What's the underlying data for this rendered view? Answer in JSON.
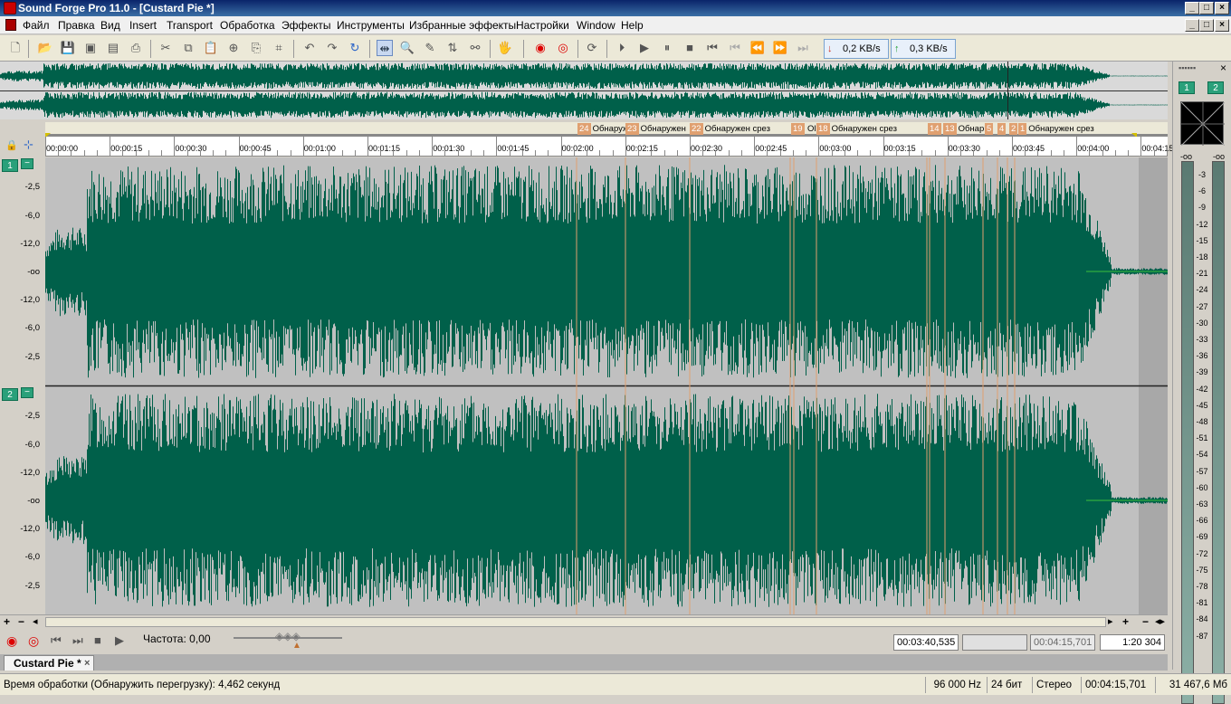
{
  "window": {
    "title": "Sound Forge Pro 11.0 - [Custard Pie *]"
  },
  "menu": [
    "Файл",
    "Правка",
    "Вид",
    "Insert",
    "Transport",
    "Обработка",
    "Эффекты",
    "Инструменты",
    "Избранные эффекты",
    "Настройки",
    "Window",
    "Help"
  ],
  "toolbar": {
    "download_rate": "0,2 KB/s",
    "upload_rate": "0,3 KB/s"
  },
  "markers": [
    {
      "num": "24",
      "label": "Обнаруж"
    },
    {
      "num": "23",
      "label": "Обнаружен"
    },
    {
      "num": "22",
      "label": "Обнаружен срез"
    },
    {
      "num": "19",
      "label": ""
    },
    {
      "num": "",
      "label": "Ol"
    },
    {
      "num": "18",
      "label": "Обнаружен срез"
    },
    {
      "num": "14",
      "label": ""
    },
    {
      "num": "13",
      "label": "Обнар"
    },
    {
      "num": "5",
      "label": ""
    },
    {
      "num": "4",
      "label": ""
    },
    {
      "num": "2",
      "label": ""
    },
    {
      "num": "1",
      "label": "Обнаружен срез"
    }
  ],
  "ruler": [
    "00:00:00",
    "00:00:15",
    "00:00:30",
    "00:00:45",
    "00:01:00",
    "00:01:15",
    "00:01:30",
    "00:01:45",
    "00:02:00",
    "00:02:15",
    "00:02:30",
    "00:02:45",
    "00:03:00",
    "00:03:15",
    "00:03:30",
    "00:03:45",
    "00:04:00",
    "00:04:15"
  ],
  "channels": [
    {
      "num": "1",
      "minimize": "−"
    },
    {
      "num": "2",
      "minimize": "−"
    }
  ],
  "db_scale": [
    "-2,5",
    "-6,0",
    "-12,0",
    "-oo",
    "-12,0",
    "-6,0",
    "-2,5"
  ],
  "meter_panel": {
    "ch1": "1",
    "ch2": "2",
    "top_left": "-oo",
    "top_right": "-oo",
    "scale": [
      "3",
      "6",
      "9",
      "12",
      "15",
      "18",
      "21",
      "24",
      "27",
      "30",
      "33",
      "36",
      "39",
      "42",
      "45",
      "48",
      "51",
      "54",
      "57",
      "60",
      "63",
      "66",
      "69",
      "72",
      "75",
      "78",
      "81",
      "84",
      "87"
    ]
  },
  "transport": {
    "frequency_label": "Частота: 0,00",
    "cursor_pos": "00:03:40,535",
    "selection": "",
    "length": "00:04:15,701",
    "zoom": "1:20 304"
  },
  "document_tab": {
    "name": "Custard Pie *",
    "close": "×"
  },
  "status": {
    "message": "Время обработки (Обнаружить перегрузку): 4,462 секунд",
    "sample_rate": "96 000 Hz",
    "bit_depth": "24 бит",
    "channels": "Стерео",
    "length": "00:04:15,701",
    "disk": "31 467,6 Мб"
  },
  "colors": {
    "waveform": "#00604a",
    "waveform_bg": "#c0c0c0",
    "marker": "#e0a070",
    "title_bar": "#0a246a"
  }
}
